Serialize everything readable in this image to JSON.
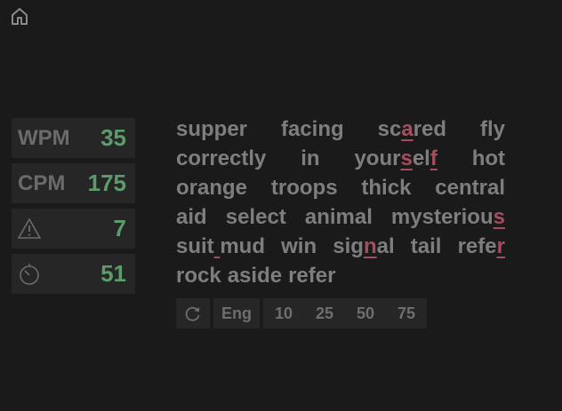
{
  "nav": {
    "home_icon": "home-icon"
  },
  "stats": {
    "wpm_label": "WPM",
    "wpm_value": "35",
    "cpm_label": "CPM",
    "cpm_value": "175",
    "errors_icon": "warning-icon",
    "errors_value": "7",
    "timer_icon": "timer-icon",
    "timer_value": "51"
  },
  "text": {
    "lines": [
      [
        [
          "supper"
        ],
        [
          "facing"
        ],
        [
          "sc",
          {
            "err": "a"
          },
          "red"
        ],
        [
          "fly"
        ]
      ],
      [
        [
          "correctly"
        ],
        [
          "in"
        ],
        [
          "your",
          {
            "err": "s"
          },
          "el",
          {
            "err": "f"
          }
        ],
        [
          "hot"
        ]
      ],
      [
        [
          "orange"
        ],
        [
          "troops"
        ],
        [
          "thick"
        ],
        [
          "central"
        ]
      ],
      [
        [
          "aid"
        ],
        [
          "select"
        ],
        [
          "animal"
        ],
        [
          "mysteriou",
          {
            "err": "s"
          }
        ]
      ],
      [
        [
          "suit",
          {
            "err": " "
          },
          "mud"
        ],
        [
          "win"
        ],
        [
          "sig",
          {
            "err": "n"
          },
          "al"
        ],
        [
          "tail"
        ],
        [
          "refe",
          {
            "err": "r"
          }
        ]
      ],
      [
        [
          "rock"
        ],
        [
          "aside"
        ],
        [
          "refer"
        ]
      ]
    ]
  },
  "toolbar": {
    "restart_icon": "restart-icon",
    "language": "Eng",
    "word_counts": [
      "10",
      "25",
      "50",
      "75"
    ]
  },
  "colors": {
    "background": "#1a1a1a",
    "panel": "#262626",
    "text_muted": "#7e7e7e",
    "value_green": "#5c9c6b",
    "error_red": "#a44e5f"
  }
}
